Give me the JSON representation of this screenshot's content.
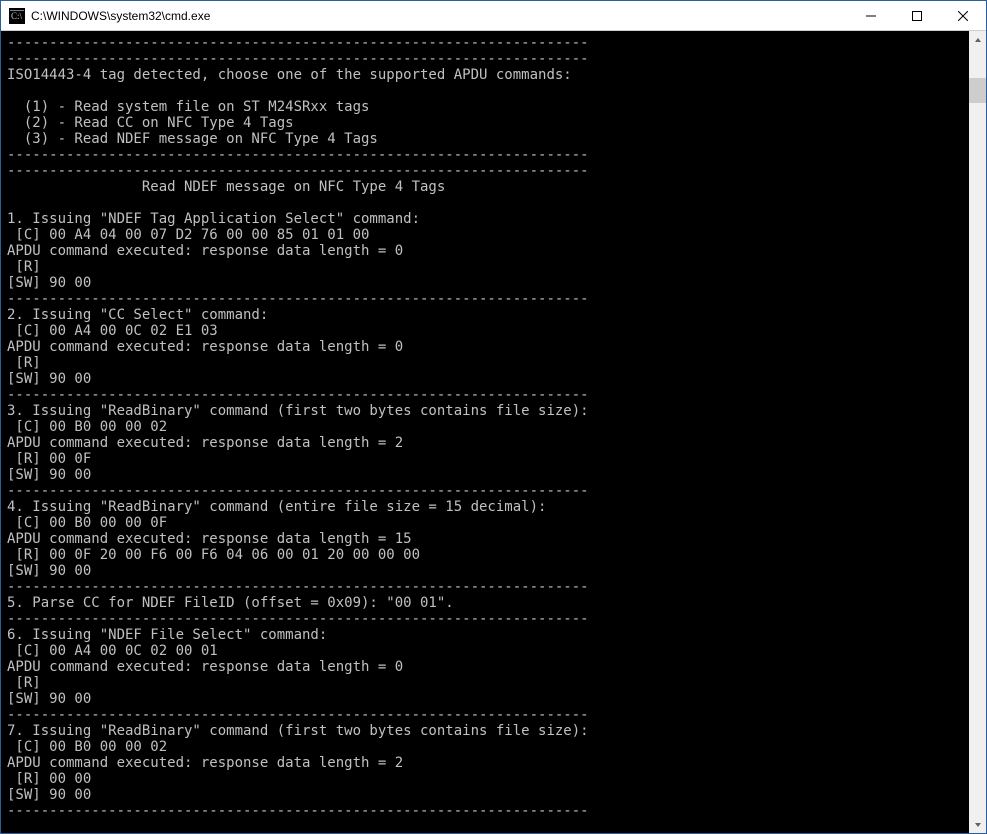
{
  "window": {
    "title": "C:\\WINDOWS\\system32\\cmd.exe",
    "icon_name": "cmd-icon"
  },
  "terminal": {
    "lines": [
      "---------------------------------------------------------------------",
      "---------------------------------------------------------------------",
      "ISO14443-4 tag detected, choose one of the supported APDU commands:",
      "",
      "  (1) - Read system file on ST M24SRxx tags",
      "  (2) - Read CC on NFC Type 4 Tags",
      "  (3) - Read NDEF message on NFC Type 4 Tags",
      "---------------------------------------------------------------------",
      "---------------------------------------------------------------------",
      "                Read NDEF message on NFC Type 4 Tags",
      "",
      "1. Issuing \"NDEF Tag Application Select\" command:",
      " [C] 00 A4 04 00 07 D2 76 00 00 85 01 01 00",
      "APDU command executed: response data length = 0",
      " [R]",
      "[SW] 90 00",
      "---------------------------------------------------------------------",
      "2. Issuing \"CC Select\" command:",
      " [C] 00 A4 00 0C 02 E1 03",
      "APDU command executed: response data length = 0",
      " [R]",
      "[SW] 90 00",
      "---------------------------------------------------------------------",
      "3. Issuing \"ReadBinary\" command (first two bytes contains file size):",
      " [C] 00 B0 00 00 02",
      "APDU command executed: response data length = 2",
      " [R] 00 0F",
      "[SW] 90 00",
      "---------------------------------------------------------------------",
      "4. Issuing \"ReadBinary\" command (entire file size = 15 decimal):",
      " [C] 00 B0 00 00 0F",
      "APDU command executed: response data length = 15",
      " [R] 00 0F 20 00 F6 00 F6 04 06 00 01 20 00 00 00",
      "[SW] 90 00",
      "---------------------------------------------------------------------",
      "5. Parse CC for NDEF FileID (offset = 0x09): \"00 01\".",
      "---------------------------------------------------------------------",
      "6. Issuing \"NDEF File Select\" command:",
      " [C] 00 A4 00 0C 02 00 01",
      "APDU command executed: response data length = 0",
      " [R]",
      "[SW] 90 00",
      "---------------------------------------------------------------------",
      "7. Issuing \"ReadBinary\" command (first two bytes contains file size):",
      " [C] 00 B0 00 00 02",
      "APDU command executed: response data length = 2",
      " [R] 00 00",
      "[SW] 90 00",
      "---------------------------------------------------------------------"
    ]
  }
}
